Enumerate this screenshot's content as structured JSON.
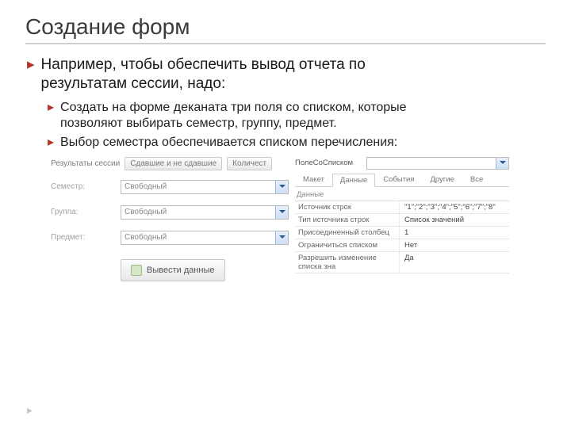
{
  "title": "Создание форм",
  "b1_line1": "Например, чтобы обеспечить вывод отчета по",
  "b1_line2": "результатам сессии, надо:",
  "b2a_l1": "Создать на форме деканата три поля со списком, которые",
  "b2a_l2": "позволяют выбирать семестр, группу, предмет.",
  "b2b": "Выбор семестра обеспечивается списком перечисления:",
  "left": {
    "resLabel": "Результаты сессии",
    "tab1": "Сдавшие и не сдавшие",
    "tab2": "Количест",
    "semLabel": "Семестр:",
    "semValue": "Свободный",
    "grpLabel": "Группа:",
    "grpValue": "Свободный",
    "subjLabel": "Предмет:",
    "subjValue": "Свободный",
    "btn": "Вывести данные"
  },
  "right": {
    "comboLabel": "ПолеСоСписком",
    "tabs": {
      "t1": "Макет",
      "t2": "Данные",
      "t3": "События",
      "t4": "Другие",
      "t5": "Все"
    },
    "section": "Данные",
    "rows": [
      {
        "k": "Источник строк",
        "v": "\"1\";\"2\";\"3\";\"4\";\"5\";\"6\";\"7\";\"8\""
      },
      {
        "k": "Тип источника строк",
        "v": "Список значений"
      },
      {
        "k": "Присоединенный столбец",
        "v": "1"
      },
      {
        "k": "Ограничиться списком",
        "v": "Нет"
      },
      {
        "k": "Разрешить изменение списка зна",
        "v": "Да"
      }
    ]
  }
}
